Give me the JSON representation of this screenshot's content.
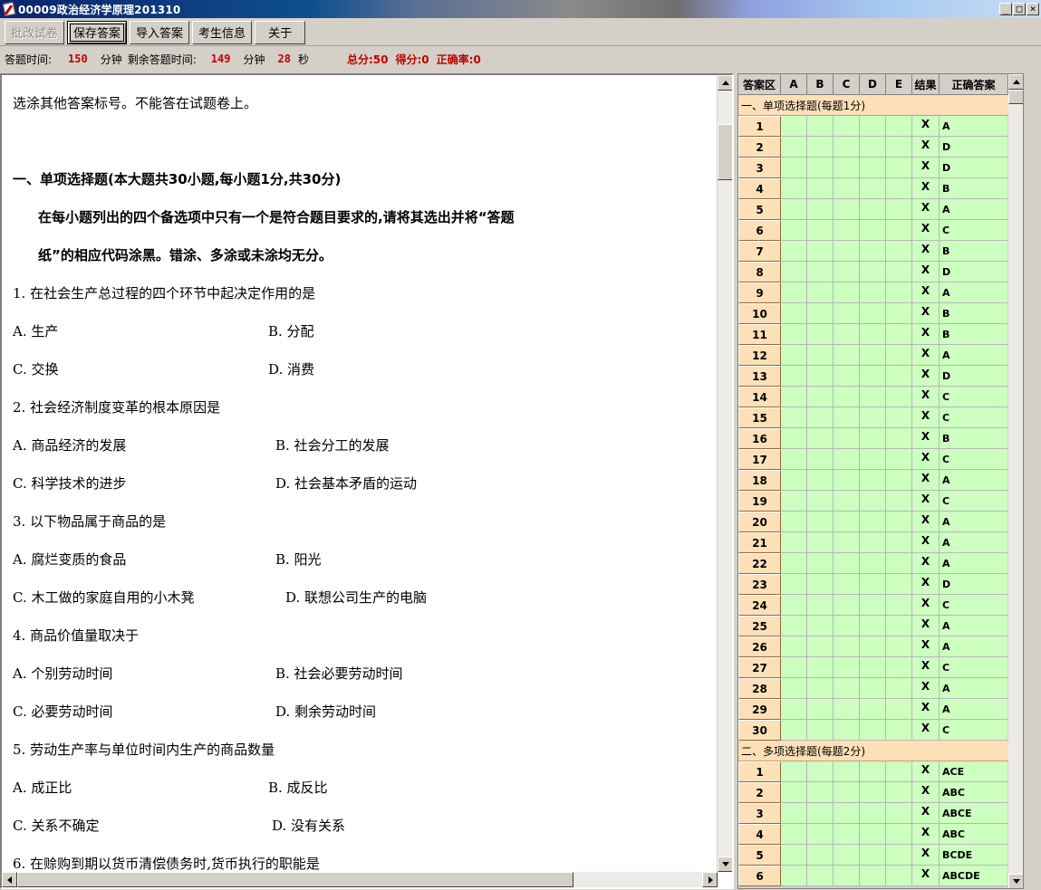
{
  "window": {
    "title": "00009政治经济学原理201310",
    "minimize": "_",
    "restore": "□",
    "close": "×"
  },
  "toolbar": {
    "grade_label": "批改试卷",
    "save_label": "保存答案",
    "import_label": "导入答案",
    "student_label": "考生信息",
    "about_label": "关于"
  },
  "status": {
    "answer_time_label": "答题时间:",
    "answer_time_value": "150",
    "minute_unit_1": "分钟",
    "remaining_label": "剩余答题时间:",
    "remaining_minutes": "149",
    "minute_unit_2": "分钟",
    "remaining_seconds": "28",
    "second_unit": "秒",
    "total_score": "总分:50",
    "earned_score": "得分:0",
    "accuracy": "正确率:0"
  },
  "questions": {
    "intro": "选涂其他答案标号。不能答在试题卷上。",
    "section1_title": "一、单项选择题(本大题共30小题,每小题1分,共30分)",
    "section1_instr_1": "在每小题列出的四个备选项中只有一个是符合题目要求的,请将其选出并将“答题",
    "section1_instr_2": "纸”的相应代码涂黑。错涂、多涂或未涂均无分。",
    "items": [
      {
        "stem": "1.  在社会生产总过程的四个环节中起决定作用的是",
        "a": "A.  生产",
        "b": "B.  分配",
        "c": "C.  交换",
        "d": "D.  消费"
      },
      {
        "stem": "2.  社会经济制度变革的根本原因是",
        "a": "A.  商品经济的发展",
        "b": "B.  社会分工的发展",
        "c": "C.  科学技术的进步",
        "d": "D.  社会基本矛盾的运动"
      },
      {
        "stem": "3.  以下物品属于商品的是",
        "a": "A.  腐烂变质的食品",
        "b": "B.  阳光",
        "c": "C.  木工做的家庭自用的小木凳",
        "d": "D.  联想公司生产的电脑"
      },
      {
        "stem": "4.  商品价值量取决于",
        "a": "A.  个别劳动时间",
        "b": "B.  社会必要劳动时间",
        "c": "C.  必要劳动时间",
        "d": "D.  剩余劳动时间"
      },
      {
        "stem": "5.  劳动生产率与单位时间内生产的商品数量",
        "a": "A.  成正比",
        "b": "B.  成反比",
        "c": "C.  关系不确定",
        "d": "D.  没有关系"
      },
      {
        "stem": "6.  在赊购到期以货币清偿债务时,货币执行的职能是"
      }
    ]
  },
  "answers": {
    "headers": [
      "答案区",
      "A",
      "B",
      "C",
      "D",
      "E",
      "结果",
      "正确答案"
    ],
    "section1_label": "一、单项选择题(每题1分)",
    "section2_label": "二、多项选择题(每题2分)",
    "section1_rows": [
      {
        "n": "1",
        "r": "X",
        "k": "A"
      },
      {
        "n": "2",
        "r": "X",
        "k": "D"
      },
      {
        "n": "3",
        "r": "X",
        "k": "D"
      },
      {
        "n": "4",
        "r": "X",
        "k": "B"
      },
      {
        "n": "5",
        "r": "X",
        "k": "A"
      },
      {
        "n": "6",
        "r": "X",
        "k": "C"
      },
      {
        "n": "7",
        "r": "X",
        "k": "B"
      },
      {
        "n": "8",
        "r": "X",
        "k": "D"
      },
      {
        "n": "9",
        "r": "X",
        "k": "A"
      },
      {
        "n": "10",
        "r": "X",
        "k": "B"
      },
      {
        "n": "11",
        "r": "X",
        "k": "B"
      },
      {
        "n": "12",
        "r": "X",
        "k": "A"
      },
      {
        "n": "13",
        "r": "X",
        "k": "D"
      },
      {
        "n": "14",
        "r": "X",
        "k": "C"
      },
      {
        "n": "15",
        "r": "X",
        "k": "C"
      },
      {
        "n": "16",
        "r": "X",
        "k": "B"
      },
      {
        "n": "17",
        "r": "X",
        "k": "C"
      },
      {
        "n": "18",
        "r": "X",
        "k": "A"
      },
      {
        "n": "19",
        "r": "X",
        "k": "C"
      },
      {
        "n": "20",
        "r": "X",
        "k": "A"
      },
      {
        "n": "21",
        "r": "X",
        "k": "A"
      },
      {
        "n": "22",
        "r": "X",
        "k": "A"
      },
      {
        "n": "23",
        "r": "X",
        "k": "D"
      },
      {
        "n": "24",
        "r": "X",
        "k": "C"
      },
      {
        "n": "25",
        "r": "X",
        "k": "A"
      },
      {
        "n": "26",
        "r": "X",
        "k": "A"
      },
      {
        "n": "27",
        "r": "X",
        "k": "C"
      },
      {
        "n": "28",
        "r": "X",
        "k": "A"
      },
      {
        "n": "29",
        "r": "X",
        "k": "A"
      },
      {
        "n": "30",
        "r": "X",
        "k": "C"
      }
    ],
    "section2_rows": [
      {
        "n": "1",
        "r": "X",
        "k": "ACE"
      },
      {
        "n": "2",
        "r": "X",
        "k": "ABC"
      },
      {
        "n": "3",
        "r": "X",
        "k": "ABCE"
      },
      {
        "n": "4",
        "r": "X",
        "k": "ABC"
      },
      {
        "n": "5",
        "r": "X",
        "k": "BCDE"
      },
      {
        "n": "6",
        "r": "X",
        "k": "ABCDE"
      }
    ]
  }
}
